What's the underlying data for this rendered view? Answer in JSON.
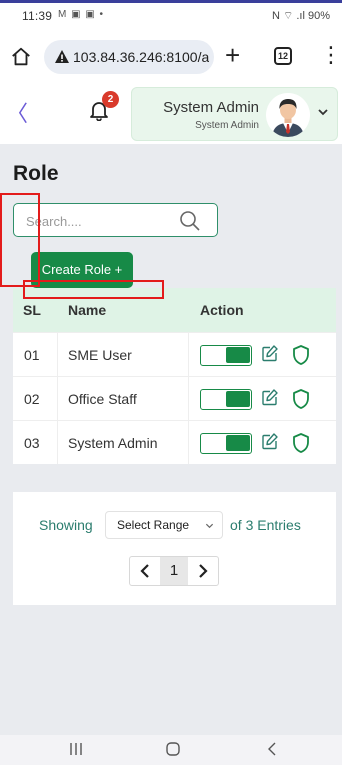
{
  "status_bar": {
    "time": "11:39",
    "notification_icons": "M ▣ ▣ •",
    "system_icons": "N ⌔ .ıl 90%"
  },
  "browser": {
    "url": "103.84.36.246:8100/a",
    "tab_count": "12"
  },
  "header": {
    "notification_count": "2",
    "user_name": "System Admin",
    "user_role": "System Admin"
  },
  "page": {
    "title": "Role",
    "search_placeholder": "Search....",
    "create_button": "Create Role +"
  },
  "table": {
    "headers": {
      "sl": "SL",
      "name": "Name",
      "action": "Action"
    },
    "rows": [
      {
        "sl": "01",
        "name": "SME User",
        "active": true
      },
      {
        "sl": "02",
        "name": "Office Staff",
        "active": true
      },
      {
        "sl": "03",
        "name": "System Admin",
        "active": true
      }
    ]
  },
  "pagination": {
    "showing_label": "Showing",
    "select_label": "Select Range",
    "entries_label": "of 3 Entries",
    "current_page": "1",
    "prev_label": "<",
    "next_label": ">"
  },
  "colors": {
    "primary_green": "#178a47",
    "teal_text": "#2b7d6e",
    "badge_red": "#d93a2b",
    "header_green": "#dff3e6"
  }
}
